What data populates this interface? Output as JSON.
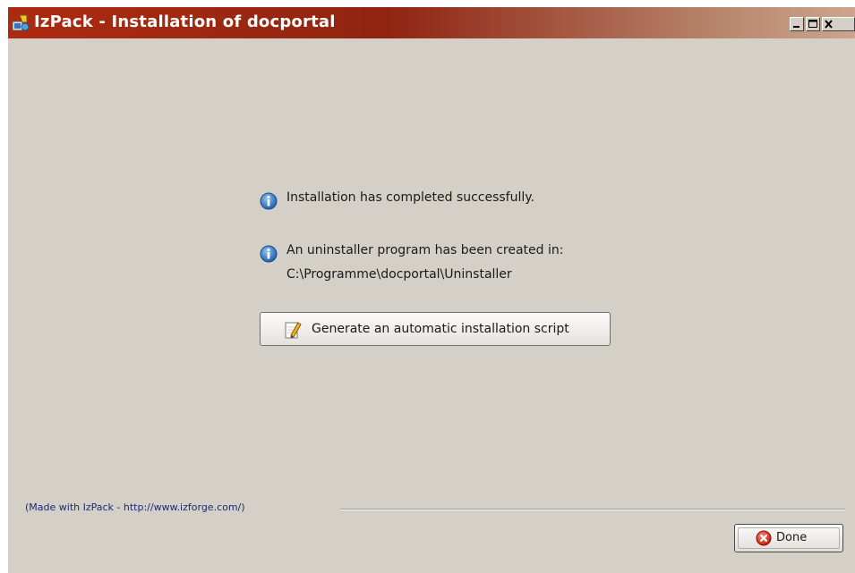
{
  "window": {
    "title": "IzPack - Installation of docportal"
  },
  "messages": {
    "success": "Installation has completed successfully.",
    "uninstaller_created": "An uninstaller program has been created in:",
    "uninstaller_path": "C:\\Programme\\docportal\\Uninstaller"
  },
  "buttons": {
    "generate_script": "Generate an automatic installation script",
    "done": "Done"
  },
  "footer": {
    "credit": "(Made with IzPack - http://www.izforge.com/)"
  },
  "colors": {
    "title_bar": "#8f2411",
    "background": "#d4d0c8",
    "credit_text": "#1a2a7a"
  },
  "icons": {
    "app": "izpack-app-icon",
    "info": "info-icon",
    "edit": "pencil-notepad-icon",
    "done": "red-x-circle-icon"
  }
}
